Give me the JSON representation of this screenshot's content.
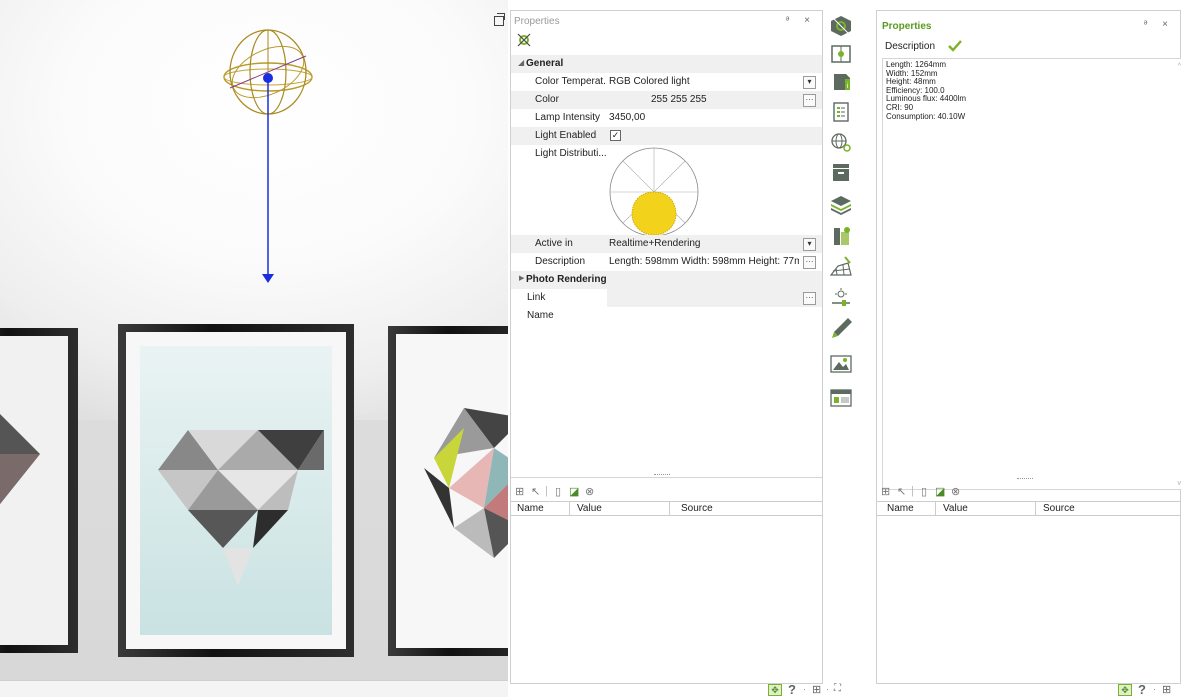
{
  "properties_panel": {
    "title": "Properties",
    "rows": {
      "color_temperature": {
        "label": "Color Temperat...",
        "value": "RGB Colored light"
      },
      "color": {
        "label": "Color",
        "value": "255 255 255"
      },
      "lamp_intensity": {
        "label": "Lamp Intensity",
        "value": "3450,00"
      },
      "light_enabled": {
        "label": "Light Enabled",
        "checked": true
      },
      "light_distribution": {
        "label": "Light Distributi..."
      },
      "active_in": {
        "label": "Active in",
        "value": "Realtime+Rendering"
      },
      "description": {
        "label": "Description",
        "value": "Length: 598mm Width: 598mm Height: 77m..."
      },
      "link": {
        "label": "Link",
        "value": ""
      },
      "name": {
        "label": "Name",
        "value": ""
      }
    },
    "sections": {
      "general": "General",
      "photo_rendering": "Photo Rendering"
    },
    "grid": {
      "headers": [
        "Name",
        "Value",
        "Source"
      ]
    }
  },
  "right_panel": {
    "title": "Properties",
    "description_label": "Description",
    "description_lines": [
      "Length: 1264mm",
      "Width: 152mm",
      "Height: 48mm",
      "Efficiency: 100.0",
      "Luminous flux: 4400lm",
      "CRI: 90",
      "Consumption: 40.10W"
    ],
    "grid": {
      "headers": [
        "Name",
        "Value",
        "Source"
      ]
    }
  },
  "colors": {
    "accent_green": "#79b428",
    "gizmo_blue": "#1a2ee0",
    "distribution_yellow": "#f2d21b"
  }
}
